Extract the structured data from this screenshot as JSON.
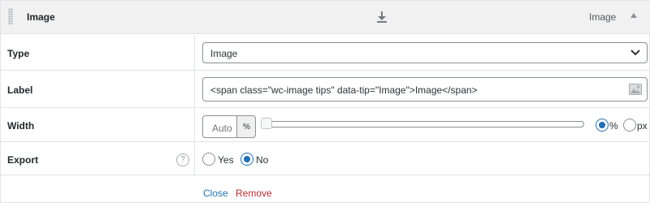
{
  "header": {
    "title": "Image",
    "type_label": "Image",
    "download_icon": "download-icon",
    "toggle_icon": "triangle-up-icon"
  },
  "fields": {
    "type": {
      "label": "Type",
      "selected": "Image"
    },
    "label": {
      "label": "Label",
      "value": "<span class=\"wc-image tips\" data-tip=\"Image\">Image</span>"
    },
    "width": {
      "label": "Width",
      "placeholder": "Auto",
      "unit_addon": "%",
      "slider_value": 0,
      "units": [
        {
          "label": "%",
          "checked": true
        },
        {
          "label": "px",
          "checked": false
        }
      ]
    },
    "export": {
      "label": "Export",
      "help_icon": "?",
      "options": [
        {
          "label": "Yes",
          "checked": false
        },
        {
          "label": "No",
          "checked": true
        }
      ]
    }
  },
  "actions": {
    "close": "Close",
    "remove": "Remove"
  },
  "colors": {
    "accent": "#2271b1",
    "danger": "#b32d2e",
    "header_bg": "#f1f1f1"
  }
}
